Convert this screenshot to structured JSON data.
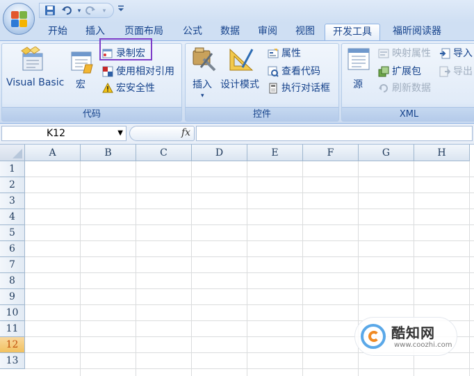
{
  "colors": {
    "ribbon_text": "#15428b",
    "highlight_box": "#7d3cc8",
    "active_row_header": "#f1c15f",
    "active_row_text": "#c2500a"
  },
  "quick_access": {
    "save_icon": "save-icon",
    "undo_icon": "undo-icon",
    "redo_icon": "redo-icon",
    "customize_icon": "customize-qat-icon"
  },
  "tabs": [
    {
      "label": "开始"
    },
    {
      "label": "插入"
    },
    {
      "label": "页面布局"
    },
    {
      "label": "公式"
    },
    {
      "label": "数据"
    },
    {
      "label": "审阅"
    },
    {
      "label": "视图"
    },
    {
      "label": "开发工具",
      "active": true
    },
    {
      "label": "福昕阅读器"
    }
  ],
  "ribbon": {
    "code": {
      "label": "代码",
      "visual_basic": "Visual Basic",
      "macros": "宏",
      "record_macro": "录制宏",
      "relative_refs": "使用相对引用",
      "macro_security": "宏安全性"
    },
    "controls": {
      "label": "控件",
      "insert": "插入",
      "design_mode": "设计模式",
      "properties": "属性",
      "view_code": "查看代码",
      "run_dialog": "执行对话框"
    },
    "xml": {
      "label": "XML",
      "source": "源",
      "map_properties": "映射属性",
      "expansion_packs": "扩展包",
      "refresh_data": "刷新数据",
      "import": "导入",
      "export": "导出"
    }
  },
  "formula_bar": {
    "name_box": "K12",
    "fx": "fx",
    "formula": ""
  },
  "sheet": {
    "columns": [
      "A",
      "B",
      "C",
      "D",
      "E",
      "F",
      "G",
      "H"
    ],
    "rows": [
      "1",
      "2",
      "3",
      "4",
      "5",
      "6",
      "7",
      "8",
      "9",
      "10",
      "11",
      "12",
      "13"
    ],
    "active_row": "12"
  },
  "watermark": {
    "title": "酷知网",
    "url": "www.coozhi.com"
  }
}
